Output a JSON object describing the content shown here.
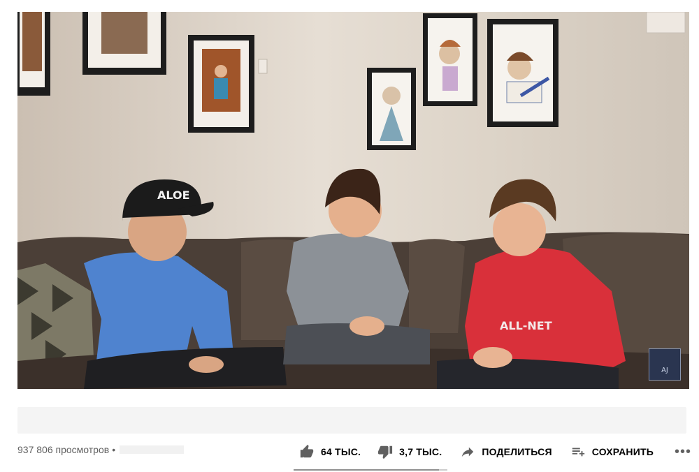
{
  "video": {
    "cap_text": "ALOE",
    "shirt_text": "ALL-NET",
    "watermark_icon": "channel-watermark-icon",
    "watermark_text": "AJ"
  },
  "info": {
    "views": "937 806 просмотров",
    "separator": "•"
  },
  "actions": {
    "like": {
      "label": "64 ТЫС.",
      "icon": "thumb-up-icon"
    },
    "dislike": {
      "label": "3,7 ТЫС.",
      "icon": "thumb-down-icon"
    },
    "share": {
      "label": "ПОДЕЛИТЬСЯ",
      "icon": "share-arrow-icon"
    },
    "save": {
      "label": "СОХРАНИТЬ",
      "icon": "playlist-add-icon"
    },
    "more": {
      "label": "•••",
      "icon": "more-horizontal-icon"
    }
  },
  "sentiment": {
    "like_ratio": 0.945
  },
  "colors": {
    "text_primary": "#030303",
    "text_secondary": "#606060",
    "sentiment_like": "#909090",
    "sentiment_bg": "#cccccc"
  }
}
